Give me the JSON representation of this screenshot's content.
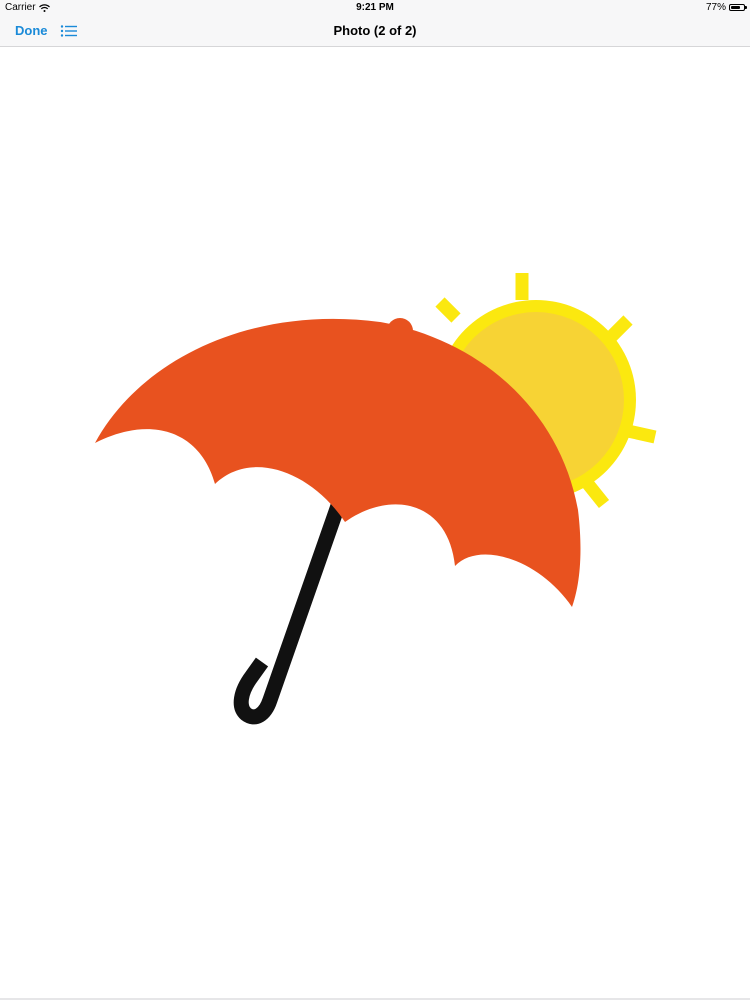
{
  "status_bar": {
    "carrier": "Carrier",
    "time": "9:21 PM",
    "battery_text": "77%",
    "battery_level": 0.77
  },
  "nav_bar": {
    "done_label": "Done",
    "title": "Photo (2 of 2)",
    "list_icon": "list-icon",
    "accent_color": "#1a8ad8"
  },
  "photo": {
    "umbrella_color": "#e8521f",
    "sun_color": "#f7d334",
    "sun_ring_color": "#fbe80f",
    "handle_color": "#111111"
  }
}
